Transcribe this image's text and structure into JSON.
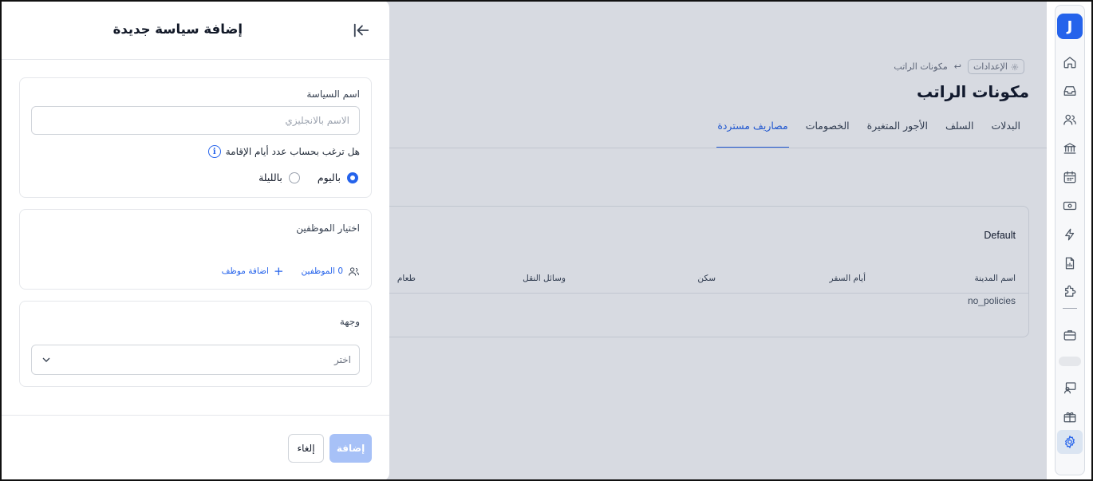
{
  "breadcrumb": {
    "settings": "الإعدادات",
    "current": "مكونات الراتب"
  },
  "page": {
    "title": "مكونات الراتب"
  },
  "tabs": [
    {
      "label": "البدلات"
    },
    {
      "label": "السلف"
    },
    {
      "label": "الأجور المتغيرة"
    },
    {
      "label": "الخصومات"
    },
    {
      "label": "مصاريف مستردة",
      "active": true
    }
  ],
  "card": {
    "title": "Default",
    "columns": [
      "اسم المدينة",
      "أيام السفر",
      "سكن",
      "وسائل النقل",
      "طعام"
    ],
    "empty": "no_policies"
  },
  "rail": {
    "logo": "J",
    "active": "settings-icon"
  },
  "drawer": {
    "title": "إضافة سياسة جديدة",
    "policy_name": {
      "label": "اسم السياسة",
      "placeholder": "الاسم بالانجليزي"
    },
    "question": "هل ترغب بحساب عدد أيام الإقامة",
    "radios": {
      "day": "باليوم",
      "night": "بالليلة",
      "selected": "day"
    },
    "employees": {
      "label": "اختيار الموظفين",
      "count": "0 الموظفين",
      "add": "اضافة موظف"
    },
    "destination": {
      "label": "وجهة",
      "placeholder": "اختر"
    },
    "buttons": {
      "add": "إضافة",
      "cancel": "إلغاء"
    }
  },
  "colors": {
    "accent": "#2563eb",
    "add_button_disabled": "#a7c1f7"
  }
}
